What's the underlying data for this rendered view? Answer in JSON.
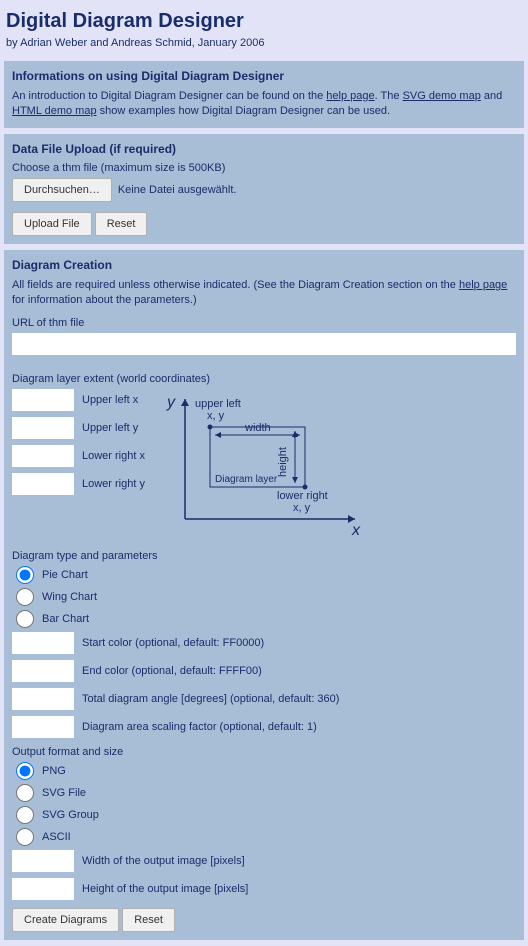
{
  "header": {
    "title": "Digital Diagram Designer",
    "byline": "by Adrian Weber and Andreas Schmid, January 2006"
  },
  "info_panel": {
    "title": "Informations on using Digital Diagram Designer",
    "intro_pre": "An introduction to Digital Diagram Designer can be found on the ",
    "help_link": "help page",
    "intro_mid1": ". The ",
    "svg_link": "SVG demo map",
    "intro_mid2": " and ",
    "html_link": "HTML demo map",
    "intro_post": " show examples how Digital Diagram Designer can be used."
  },
  "upload_panel": {
    "title": "Data File Upload (if required)",
    "choose_label": "Choose a thm file (maximum size is 500KB)",
    "browse_button": "Durchsuchen…",
    "no_file": "Keine Datei ausgewählt.",
    "upload_button": "Upload File",
    "reset_button": "Reset"
  },
  "creation_panel": {
    "title": "Diagram Creation",
    "desc_pre": "All fields are required unless otherwise indicated. (See the Diagram Creation section on the ",
    "help_link": "help page",
    "desc_post": " for information about the parameters.)",
    "url_label": "URL of thm file",
    "extent_label": "Diagram layer extent (world coordinates)",
    "coords": {
      "ulx": "Upper left x",
      "uly": "Upper left y",
      "lrx": "Lower right x",
      "lry": "Lower right y"
    },
    "diagram_svg": {
      "y_axis": "y",
      "x_axis": "x",
      "upper_left": "upper left",
      "ul_xy": "x, y",
      "width": "width",
      "height": "height",
      "layer": "Diagram layer",
      "lower_right": "lower right",
      "lr_xy": "x, y"
    },
    "type_label": "Diagram type and parameters",
    "types": {
      "pie": "Pie Chart",
      "wing": "Wing Chart",
      "bar": "Bar Chart"
    },
    "params": {
      "start_color": "Start color (optional, default: FF0000)",
      "end_color": "End color (optional, default: FFFF00)",
      "angle": "Total diagram angle [degrees] (optional, default: 360)",
      "scale": "Diagram area scaling factor (optional, default: 1)"
    },
    "output_label": "Output format and size",
    "formats": {
      "png": "PNG",
      "svg_file": "SVG File",
      "svg_group": "SVG Group",
      "ascii": "ASCII"
    },
    "dims": {
      "width": "Width of the output image [pixels]",
      "height": "Height of the output image [pixels]"
    },
    "create_button": "Create Diagrams",
    "reset_button": "Reset"
  }
}
